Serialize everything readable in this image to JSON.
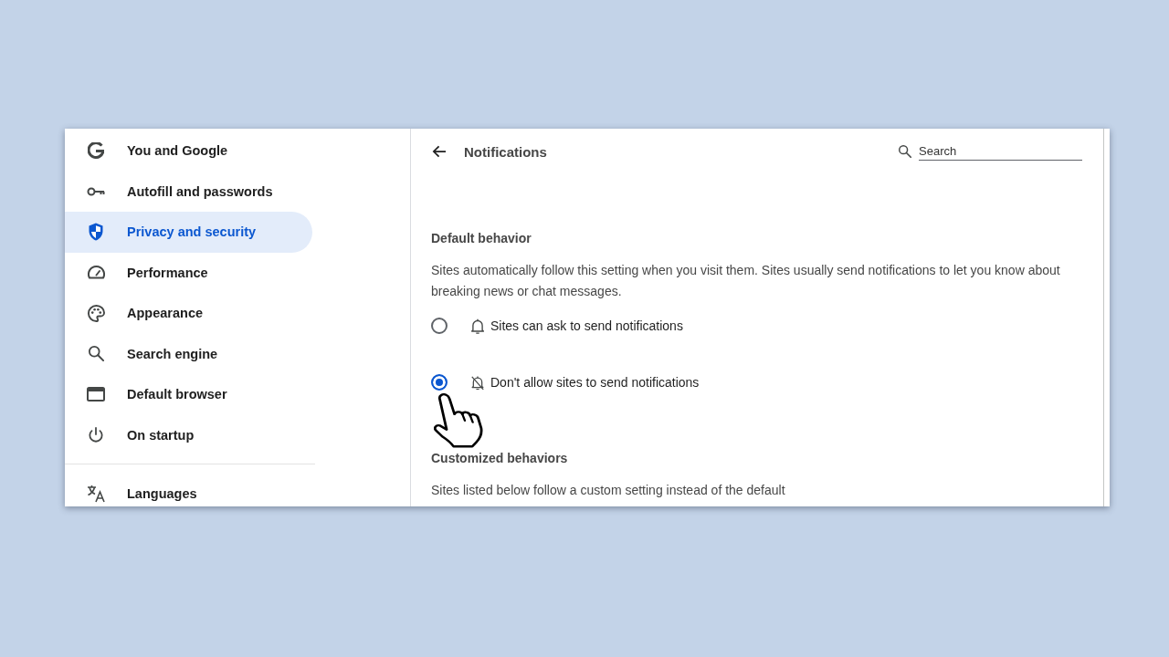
{
  "sidebar": {
    "items": [
      {
        "label": "You and Google",
        "selected": false
      },
      {
        "label": "Autofill and passwords",
        "selected": false
      },
      {
        "label": "Privacy and security",
        "selected": true
      },
      {
        "label": "Performance",
        "selected": false
      },
      {
        "label": "Appearance",
        "selected": false
      },
      {
        "label": "Search engine",
        "selected": false
      },
      {
        "label": "Default browser",
        "selected": false
      },
      {
        "label": "On startup",
        "selected": false
      }
    ],
    "more_items": [
      {
        "label": "Languages",
        "selected": false
      }
    ]
  },
  "page": {
    "title": "Notifications",
    "search": {
      "placeholder": "Search"
    },
    "sections": [
      {
        "heading": "Default behavior",
        "description": "Sites automatically follow this setting when you visit them. Sites usually send notifications to let you know about breaking news or chat messages.",
        "options": [
          {
            "label": "Sites can ask to send notifications",
            "selected": false
          },
          {
            "label": "Don't allow sites to send notifications",
            "selected": true
          }
        ]
      },
      {
        "heading": "Customized behaviors",
        "description": "Sites listed below follow a custom setting instead of the default"
      }
    ]
  }
}
